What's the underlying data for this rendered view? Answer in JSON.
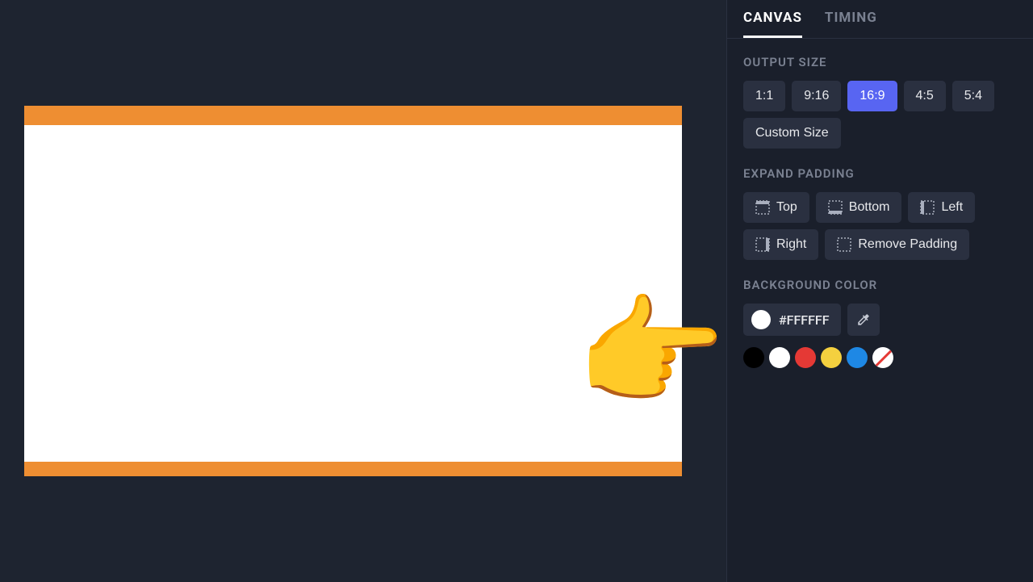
{
  "tabs": {
    "canvas": "CANVAS",
    "timing": "TIMING"
  },
  "sections": {
    "output_size": "OUTPUT SIZE",
    "expand_padding": "EXPAND PADDING",
    "background_color": "BACKGROUND COLOR"
  },
  "output_size": {
    "r1x1": "1:1",
    "r9x16": "9:16",
    "r16x9": "16:9",
    "r4x5": "4:5",
    "r5x4": "5:4",
    "custom": "Custom Size"
  },
  "padding": {
    "top": "Top",
    "bottom": "Bottom",
    "left": "Left",
    "right": "Right",
    "remove": "Remove Padding"
  },
  "bg_color": {
    "hex": "#FFFFFF",
    "swatches": {
      "black": "#000000",
      "white": "#FFFFFF",
      "red": "#E53935",
      "yellow": "#F4D03F",
      "blue": "#1E88E5"
    }
  },
  "canvas": {
    "frame_color": "#EE8E32",
    "bg": "#FFFFFF"
  }
}
